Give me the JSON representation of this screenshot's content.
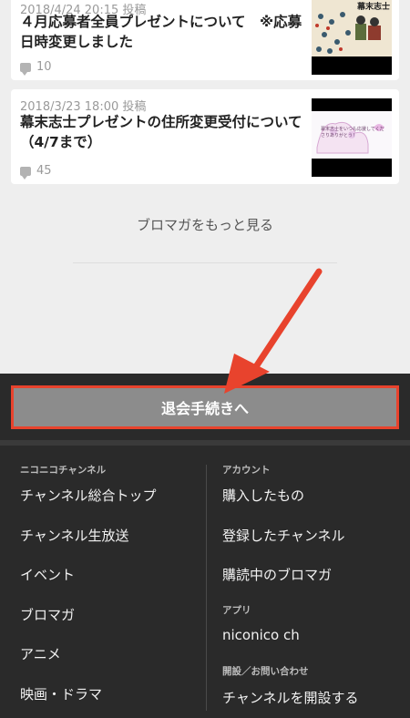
{
  "posts": [
    {
      "date": "2018/4/24 20:15 投稿",
      "title": "４月応募者全員プレゼントについて　※応募日時変更しました",
      "comments": "10",
      "thumb_text": "幕末志士"
    },
    {
      "date": "2018/3/23 18:00 投稿",
      "title": "幕末志士プレゼントの住所変更受付について（4/7まで）",
      "comments": "45",
      "thumb_text": "幕末志士をいつも応援してくださりありがとう！"
    }
  ],
  "more_link": "ブロマガをもっと見る",
  "withdraw_button": "退会手続きへ",
  "footer": {
    "left_heading": "ニコニコチャンネル",
    "left_links": [
      "チャンネル総合トップ",
      "チャンネル生放送",
      "イベント",
      "ブロマガ",
      "アニメ",
      "映画・ドラマ"
    ],
    "account_heading": "アカウント",
    "account_links": [
      "購入したもの",
      "登録したチャンネル",
      "購読中のブロマガ"
    ],
    "app_heading": "アプリ",
    "app_links": [
      "niconico ch"
    ],
    "open_heading": "開設／お問い合わせ",
    "open_links": [
      "チャンネルを開設する"
    ]
  },
  "colors": {
    "highlight": "#e8432d",
    "button": "#8c8c8c",
    "footer": "#2a2a2a"
  }
}
